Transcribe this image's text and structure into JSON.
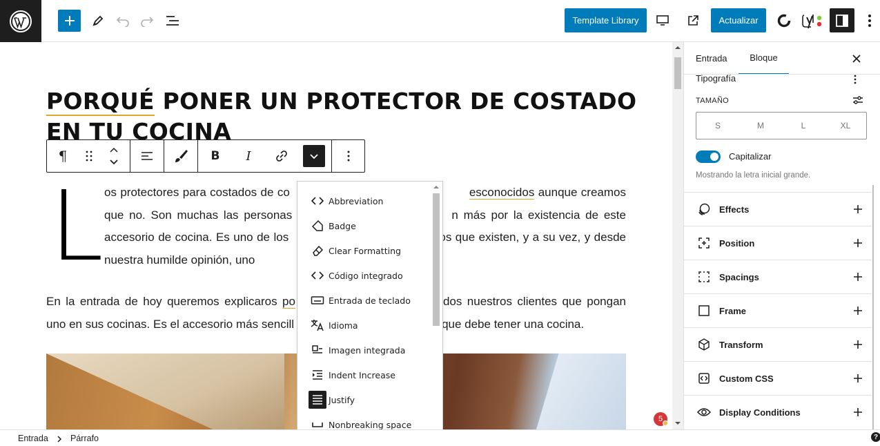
{
  "topbar": {
    "template_library_label": "Template Library",
    "update_label": "Actualizar"
  },
  "post": {
    "title_line1_underlined": "PORQUÉ",
    "title_line1_rest": " PONER UN PROTECTOR DE COSTADO",
    "title_line2": "EN TU COCINA",
    "dropcap": "L",
    "para1_a": "os protectores para costados de co",
    "para1_link": "esconocidos",
    "para1_b": " aunque creamos que no. Son muchas las personas que",
    "para1_c": "n más por la existencia de este accesorio de cocina. Es uno de los",
    "para1_d": "de los que existen, y a su vez, y desde nuestra humilde opinión, uno",
    "para2_a": "En la entrada de hoy queremos explicaros ",
    "para2_link": "po",
    "para2_b": "dos nuestros clientes que pongan uno en sus cocinas. Es el accesorio más sencill",
    "para2_c": "que debe tener una cocina."
  },
  "block_toolbar": {
    "paragraph_symbol": "¶",
    "bold_label": "B",
    "italic_label": "I"
  },
  "format_menu": {
    "items": [
      {
        "label": "Abbreviation",
        "icon": "code-icon"
      },
      {
        "label": "Badge",
        "icon": "tag-icon"
      },
      {
        "label": "Clear Formatting",
        "icon": "eraser-icon"
      },
      {
        "label": "Código integrado",
        "icon": "code-icon"
      },
      {
        "label": "Entrada de teclado",
        "icon": "keyboard-icon"
      },
      {
        "label": "Idioma",
        "icon": "translate-icon"
      },
      {
        "label": "Imagen integrada",
        "icon": "inline-image-icon"
      },
      {
        "label": "Indent Increase",
        "icon": "indent-icon"
      },
      {
        "label": "Justify",
        "icon": "justify-icon"
      },
      {
        "label": "Nonbreaking space",
        "icon": "space-icon"
      }
    ]
  },
  "sidebar": {
    "tab_post": "Entrada",
    "tab_block": "Bloque",
    "typography_label": "Tipografía",
    "size_label": "TAMAÑO",
    "sizes": [
      "S",
      "M",
      "L",
      "XL"
    ],
    "capitalize_label": "Capitalizar",
    "capitalize_help": "Mostrando la letra inicial grande.",
    "sections": [
      {
        "label": "Effects",
        "icon": "effects-icon"
      },
      {
        "label": "Position",
        "icon": "position-icon"
      },
      {
        "label": "Spacings",
        "icon": "spacings-icon"
      },
      {
        "label": "Frame",
        "icon": "frame-icon"
      },
      {
        "label": "Transform",
        "icon": "transform-icon"
      },
      {
        "label": "Custom CSS",
        "icon": "custom-css-icon"
      },
      {
        "label": "Display Conditions",
        "icon": "eye-icon"
      }
    ]
  },
  "breadcrumb": {
    "root": "Entrada",
    "current": "Párrafo"
  },
  "notifications": {
    "count": "5"
  },
  "colors": {
    "accent": "#007cba",
    "dark": "#1e1e1e",
    "link_underline": "#e0a52c"
  }
}
